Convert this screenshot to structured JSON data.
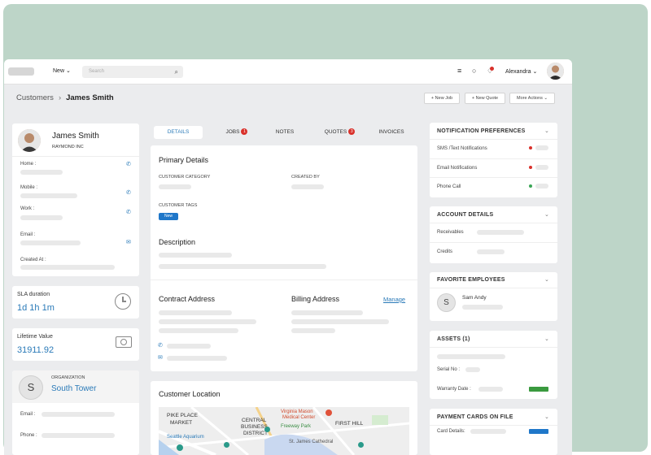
{
  "topbar": {
    "new_label": "New",
    "search_placeholder": "Search",
    "user_name": "Alexandra"
  },
  "breadcrumb": {
    "parent": "Customers",
    "current": "James Smith"
  },
  "actions": {
    "new_job": "+ New Job",
    "new_quote": "+ New Quote",
    "more": "More Actions"
  },
  "customer": {
    "name": "James Smith",
    "company": "RAYMOND INC",
    "fields": [
      "Home :",
      "Mobile :",
      "Work :",
      "Email :",
      "Created At :"
    ]
  },
  "sla": {
    "label": "SLA duration",
    "value": "1d 1h 1m"
  },
  "lifetime": {
    "label": "Lifetime Value",
    "value": "31911.92"
  },
  "organization": {
    "initial": "S",
    "label": "ORGANIZATION",
    "name": "South Tower",
    "fields": [
      "Email :",
      "Phone :"
    ]
  },
  "tabs": [
    {
      "label": "DETAILS",
      "count": ""
    },
    {
      "label": "JOBS",
      "count": "1"
    },
    {
      "label": "NOTES",
      "count": ""
    },
    {
      "label": "QUOTES",
      "count": "3"
    },
    {
      "label": "INVOICES",
      "count": ""
    }
  ],
  "primary": {
    "title": "Primary Details",
    "category_label": "CUSTOMER CATEGORY",
    "created_by_label": "CREATED BY",
    "tags_label": "CUSTOMER TAGS",
    "tag": "New"
  },
  "description": {
    "title": "Description"
  },
  "contract": {
    "title": "Contract Address"
  },
  "billing": {
    "title": "Billing Address",
    "manage": "Manage"
  },
  "location": {
    "title": "Customer Location",
    "map_labels": [
      "PIKE PLACE",
      "MARKET",
      "CENTRAL",
      "BUSINESS",
      "DISTRICT",
      "Virginia Mason",
      "Medical Center",
      "FIRST HILL",
      "Freeway Park",
      "Seattle Aquarium",
      "St. James Cathedral"
    ]
  },
  "notifications": {
    "title": "NOTIFICATION PREFERENCES",
    "items": [
      {
        "label": "SMS /Text Notifications",
        "color": "#d9312b"
      },
      {
        "label": "Email Notifications",
        "color": "#d9312b"
      },
      {
        "label": "Phone Call",
        "color": "#3aa655"
      }
    ]
  },
  "account": {
    "title": "ACCOUNT DETAILS",
    "items": [
      "Receivables",
      "Credits"
    ]
  },
  "favorites": {
    "title": "FAVORITE EMPLOYEES",
    "initial": "S",
    "name": "Sam Andy"
  },
  "assets": {
    "title": "ASSETS (1)",
    "serial": "Serial No :",
    "warranty": "Warranty Date :",
    "warranty_color": "#3a9a3f"
  },
  "payment": {
    "title": "PAYMENT CARDS ON FILE",
    "card": "Card Details:",
    "card_color": "#1f77c9"
  },
  "colors": {
    "accent": "#2a7ab8",
    "badge": "#d9312b",
    "background": "#bdd5c8"
  }
}
